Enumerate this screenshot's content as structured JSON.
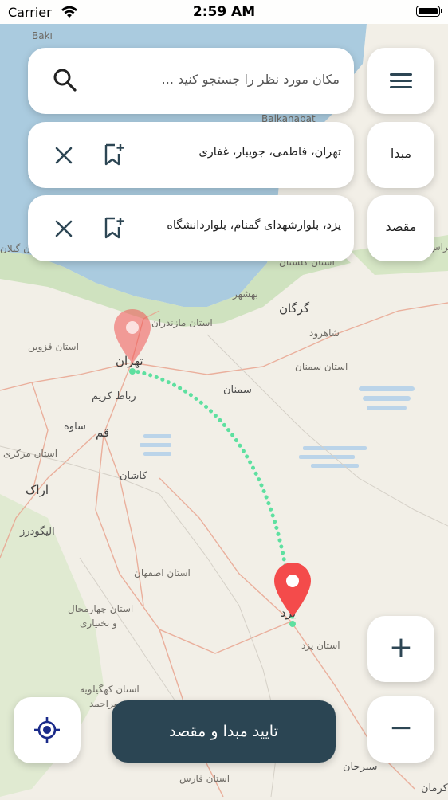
{
  "status_bar": {
    "carrier": "Carrier",
    "time": "2:59 AM"
  },
  "search": {
    "placeholder": "مکان مورد نظر را جستجو کنید ..."
  },
  "origin": {
    "label": "مبدا",
    "address": "تهران، فاطمی، جویبار، غفاری"
  },
  "destination": {
    "label": "مقصد",
    "address": "یزد، بلوارشهدای گمنام، بلواردانشگاه"
  },
  "zoom": {
    "in": "+",
    "out": "−"
  },
  "confirm_button": "تایید مبدا و مقصد",
  "map_labels": {
    "baku": "Bakı",
    "balkanabat": "Balkanabat",
    "gilan": "استان گیلان",
    "mazandaran": "استان مازندران",
    "behshahr": "بهشهر",
    "gorgan": "گرگان",
    "golestan": "استان گلستان",
    "shahrud": "شاهرود",
    "semnan_prov": "استان سمنان",
    "semnan": "سمنان",
    "qazvin": "استان قزوین",
    "tehran": "تهران",
    "robat_karim": "رباط کریم",
    "saveh": "ساوه",
    "qom": "قم",
    "markazi": "استان مرکزی",
    "kashan": "کاشان",
    "arak": "اراک",
    "aligudarz": "الیگودرز",
    "isfahan": "استان اصفهان",
    "chaharmahal": "استان چهارمحال",
    "bakhtiari": "و بختیاری",
    "yazd": "یزد",
    "yazd_prov": "استان یزد",
    "kohgiluyeh": "استان کهگیلویه",
    "boyer": "و بویراحمد",
    "fars": "استان فارس",
    "sirjan": "سیرجان",
    "kerman": "کرمان",
    "khorasan": "خراس"
  },
  "colors": {
    "accent": "#2b4553",
    "pin": "#f05454",
    "route": "#5ee0a0",
    "sea": "#a9cbe0"
  }
}
